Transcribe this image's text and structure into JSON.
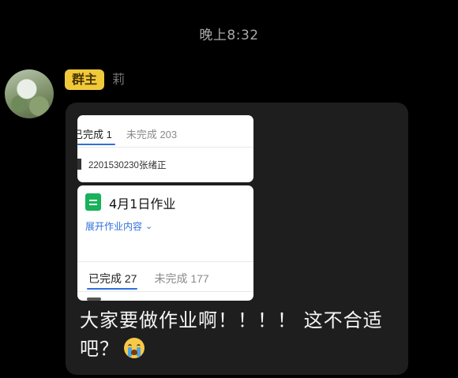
{
  "chat": {
    "timestamp": "晚上8:32"
  },
  "sender": {
    "role_badge": "群主",
    "name_fragment": "莉"
  },
  "card_top": {
    "tab_completed": "已完成 1",
    "tab_incomplete": "未完成 203",
    "row_text": "2201530230张绪正"
  },
  "card_homework": {
    "title": "4月1日作业",
    "expand_label": "展开作业内容",
    "tab_completed": "已完成 27",
    "tab_incomplete": "未完成 177"
  },
  "message": {
    "text_line": "大家要做作业啊！！！！ 这不合适吧？",
    "emoji": "loudly-crying-face"
  },
  "colors": {
    "badge": "#f0c93b",
    "link_blue": "#2f6fdc",
    "doc_green": "#17b25a",
    "bubble": "#1e1e1e"
  }
}
